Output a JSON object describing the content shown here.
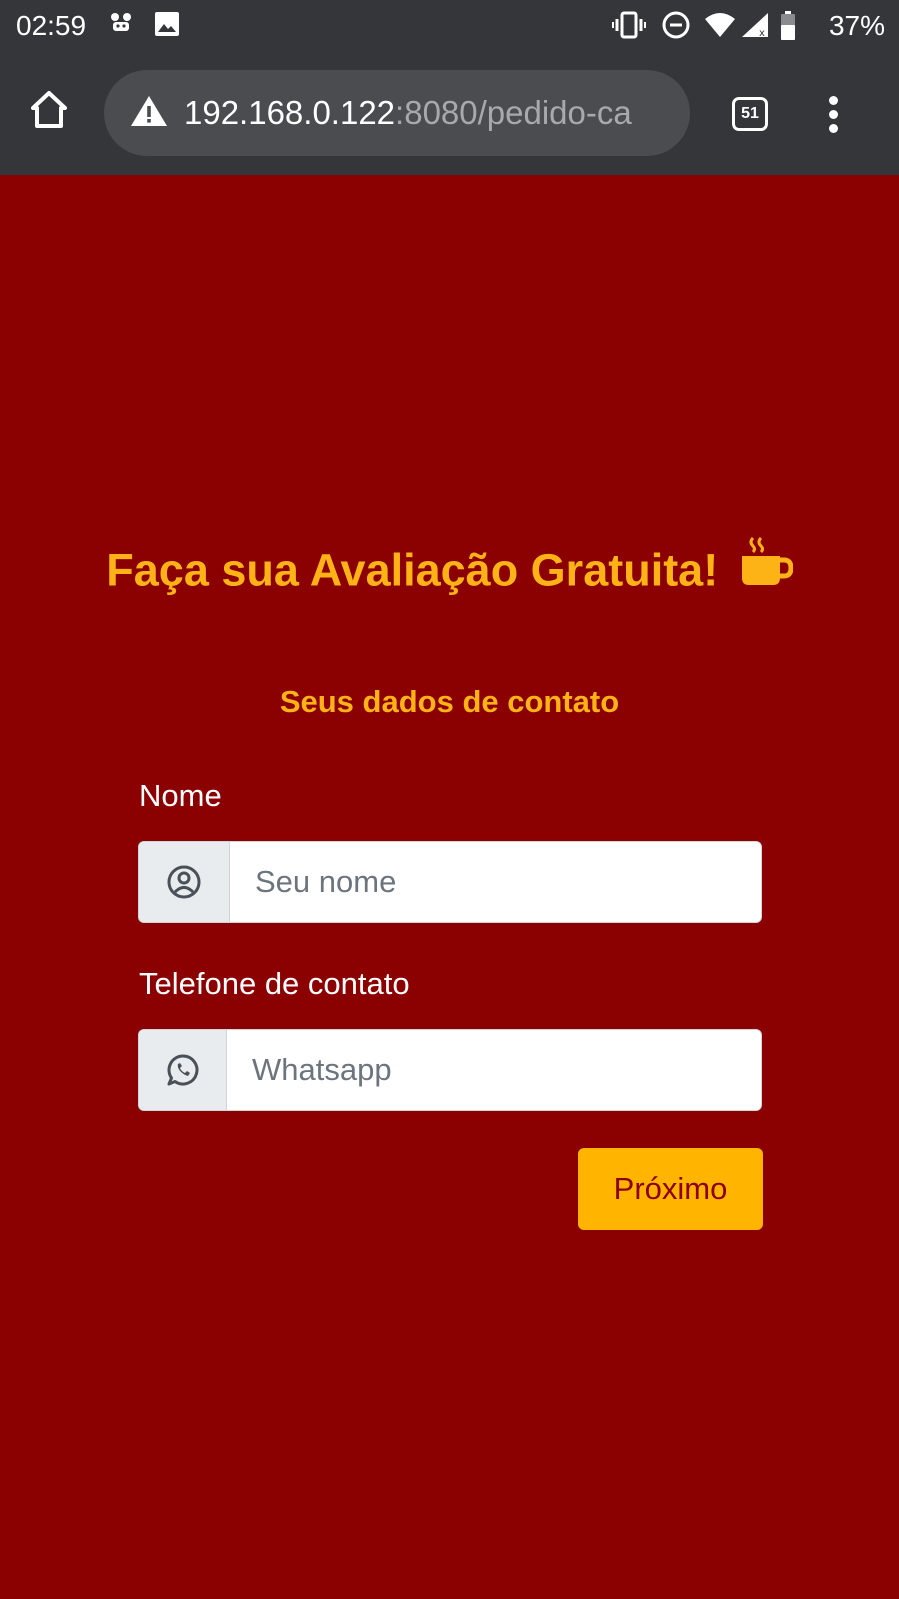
{
  "status_bar": {
    "time": "02:59",
    "battery_percent": "37%",
    "icons": [
      "notification-icon",
      "image-icon",
      "vibrate-icon",
      "do-not-disturb-icon",
      "wifi-icon",
      "signal-icon",
      "battery-icon"
    ]
  },
  "browser": {
    "url_host": "192.168.0.122",
    "url_rest": ":8080/pedido-ca",
    "tab_count": "51",
    "icons": [
      "home-icon",
      "warning-icon",
      "tabs-icon",
      "more-vert-icon"
    ]
  },
  "page": {
    "title": "Faça sua Avaliação Gratuita!",
    "title_icon": "coffee-icon",
    "subtitle": "Seus dados de contato",
    "name_field": {
      "label": "Nome",
      "placeholder": "Seu nome",
      "value": "",
      "icon": "user-circle-icon"
    },
    "phone_field": {
      "label": "Telefone de contato",
      "placeholder": "Whatsapp",
      "value": "",
      "icon": "whatsapp-icon"
    },
    "next_button_label": "Próximo"
  },
  "colors": {
    "background": "#8b0000",
    "accent": "#fdb316",
    "button": "#ffb400",
    "browser_chrome": "#35363a"
  }
}
